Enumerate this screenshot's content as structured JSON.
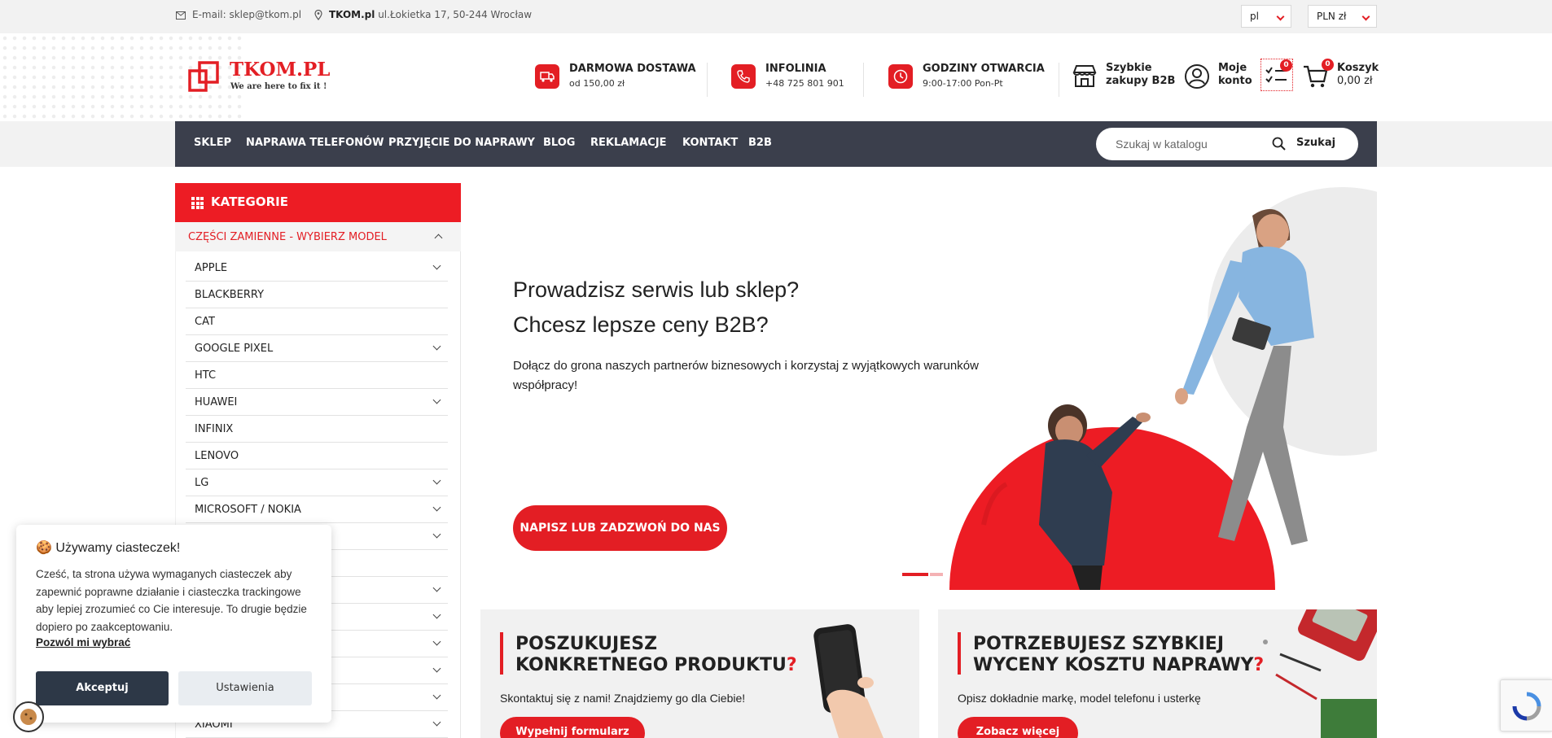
{
  "topbar": {
    "email": "E-mail: sklep@tkom.pl",
    "address_bold": "TKOM.pl",
    "address": "ul.Łokietka 17, 50-244 Wrocław",
    "language": "pl",
    "currency": "PLN zł"
  },
  "header": {
    "logo_text": "TKOM.PL",
    "logo_tagline": "We are here to fix it !",
    "info": [
      {
        "title": "DARMOWA DOSTAWA",
        "sub": "od 150,00 zł",
        "icon": "truck-icon"
      },
      {
        "title": "INFOLINIA",
        "sub": "+48 725 801 901",
        "icon": "phone-icon"
      },
      {
        "title": "GODZINY OTWARCIA",
        "sub": "9:00-17:00 Pon-Pt",
        "icon": "clock-icon"
      }
    ],
    "b2b_line1": "Szybkie",
    "b2b_line2": "zakupy B2B",
    "account_line1": "Moje",
    "account_line2": "konto",
    "compare_count": "0",
    "cart_count": "0",
    "cart_line1": "Koszyk",
    "cart_line2": "0,00 zł"
  },
  "nav": {
    "items": [
      "SKLEP",
      "NAPRAWA TELEFONÓW",
      "PRZYJĘCIE DO NAPRAWY",
      "BLOG",
      "REKLAMACJE",
      "KONTAKT",
      "B2B"
    ],
    "search_placeholder": "Szukaj w katalogu",
    "search_button": "Szukaj"
  },
  "sidebar": {
    "title": "KATEGORIE",
    "subheading": "CZĘŚCI ZAMIENNE - WYBIERZ MODEL",
    "categories": [
      {
        "label": "APPLE",
        "expandable": true
      },
      {
        "label": "BLACKBERRY",
        "expandable": false
      },
      {
        "label": "CAT",
        "expandable": false
      },
      {
        "label": "GOOGLE PIXEL",
        "expandable": true
      },
      {
        "label": "HTC",
        "expandable": false
      },
      {
        "label": "HUAWEI",
        "expandable": true
      },
      {
        "label": "INFINIX",
        "expandable": false
      },
      {
        "label": "LENOVO",
        "expandable": false
      },
      {
        "label": "LG",
        "expandable": true
      },
      {
        "label": "MICROSOFT / NOKIA",
        "expandable": true
      },
      {
        "label": "",
        "expandable": true
      },
      {
        "label": "",
        "expandable": false
      },
      {
        "label": "",
        "expandable": true
      },
      {
        "label": "",
        "expandable": true
      },
      {
        "label": "",
        "expandable": true
      },
      {
        "label": "",
        "expandable": true
      },
      {
        "label": "",
        "expandable": true
      },
      {
        "label": "XIAOMI",
        "expandable": true
      }
    ]
  },
  "hero": {
    "title_line1": "Prowadzisz serwis lub sklep?",
    "title_line2": "Chcesz lepsze ceny B2B?",
    "text": "Dołącz do grona naszych partnerów biznesowych i korzystaj z wyjątkowych warunków współpracy!",
    "button": "NAPISZ LUB ZADZWOŃ DO NAS"
  },
  "cards": [
    {
      "title_line1": "POSZUKUJESZ",
      "title_line2": "KONKRETNEGO PRODUKTU",
      "q": "?",
      "text": "Skontaktuj się z nami! Znajdziemy go dla Ciebie!",
      "button": "Wypełnij formularz"
    },
    {
      "title_line1": "POTRZEBUJESZ SZYBKIEJ",
      "title_line2": "WYCENY KOSZTU NAPRAWY",
      "q": "?",
      "text": "Opisz dokładnie markę, model telefonu i usterkę",
      "button": "Zobacz więcej"
    }
  ],
  "cookie": {
    "title": "Używamy ciasteczek!",
    "body": "Cześć, ta strona używa wymaganych ciasteczek aby zapewnić poprawne działanie i ciasteczka trackingowe aby lepiej zrozumieć co Cie interesuje. To drugie będzie dopiero po zaakceptowaniu.",
    "link": "Pozwól mi wybrać",
    "accept": "Akceptuj",
    "settings": "Ustawienia"
  },
  "colors": {
    "accent": "#e31e24",
    "nav_bg": "#3b3f4c",
    "dark_button": "#2d3847"
  }
}
